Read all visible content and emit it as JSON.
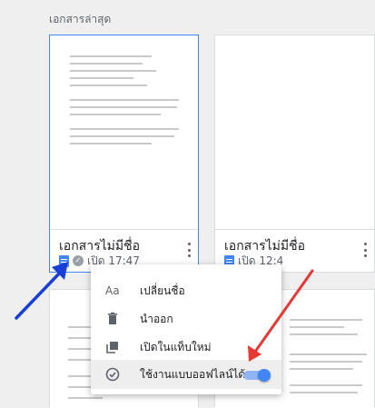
{
  "section": {
    "title": "เอกสารล่าสุด"
  },
  "documents": [
    {
      "title": "เอกสารไม่มีชื่อ",
      "meta": "เปิด 17:47",
      "offline_badge": "✓"
    },
    {
      "title": "เอกสารไม่มีชื่อ",
      "meta": "เปิด 12:4"
    }
  ],
  "context_menu": {
    "items": [
      {
        "icon": "rename-icon",
        "icon_glyph": "Aa",
        "label": "เปลี่ยนชื่อ"
      },
      {
        "icon": "trash-icon",
        "label": "นำออก"
      },
      {
        "icon": "open-new-tab-icon",
        "label": "เปิดในแท็บใหม่"
      },
      {
        "icon": "offline-check-icon",
        "label": "ใช้งานแบบออฟไลน์ได้",
        "toggle_on": true
      }
    ]
  },
  "colors": {
    "accent_blue": "#4285f4",
    "arrow_red": "#e53935",
    "arrow_blue": "#1a3fd6"
  }
}
